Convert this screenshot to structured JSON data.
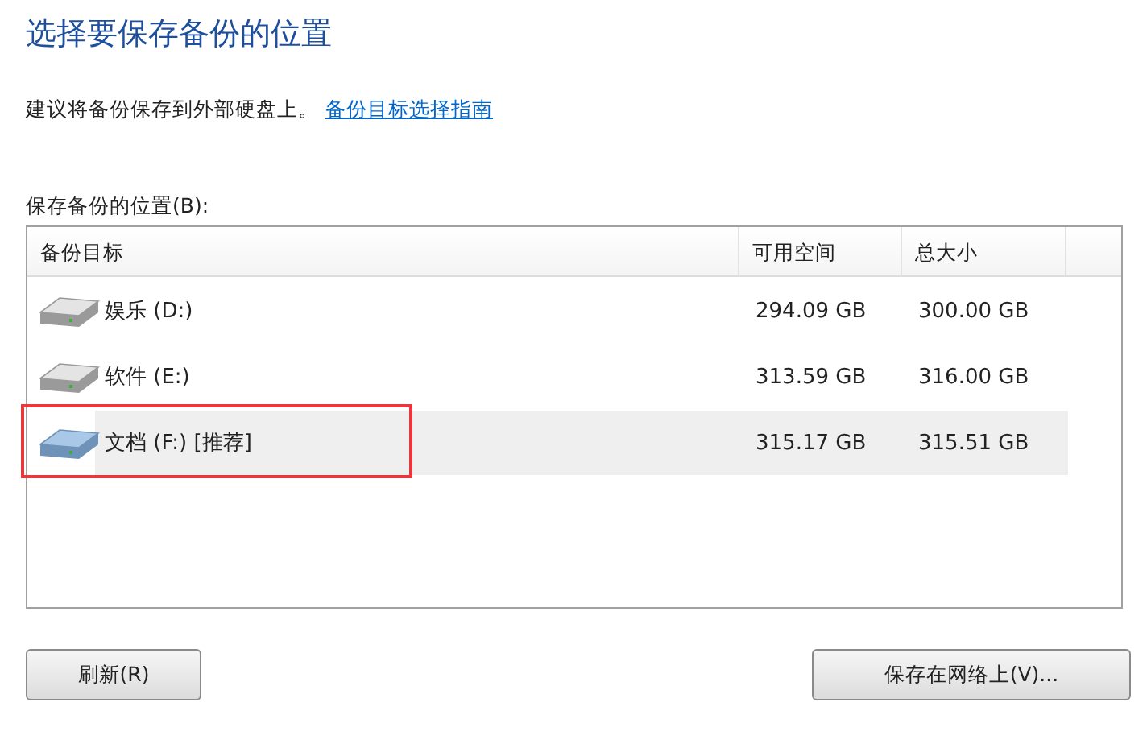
{
  "title": "选择要保存备份的位置",
  "intro": {
    "text": "建议将备份保存到外部硬盘上。",
    "link": "备份目标选择指南"
  },
  "list_label": "保存备份的位置(B):",
  "table": {
    "columns": [
      "备份目标",
      "可用空间",
      "总大小"
    ],
    "rows": [
      {
        "name": "娱乐 (D:)",
        "free": "294.09 GB",
        "total": "300.00 GB",
        "selected": false,
        "highlighted": false
      },
      {
        "name": "软件 (E:)",
        "free": "313.59 GB",
        "total": "316.00 GB",
        "selected": false,
        "highlighted": false
      },
      {
        "name": "文档 (F:) [推荐]",
        "free": "315.17 GB",
        "total": "315.51 GB",
        "selected": true,
        "highlighted": true
      }
    ]
  },
  "buttons": {
    "refresh": "刷新(R)",
    "network": "保存在网络上(V)..."
  }
}
